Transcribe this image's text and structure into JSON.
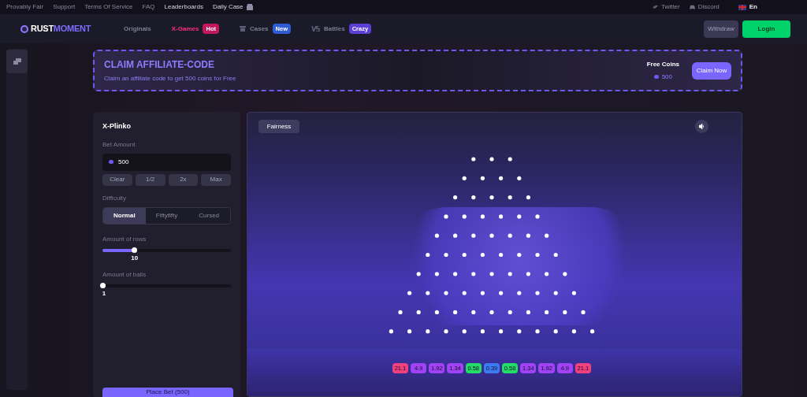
{
  "top_links": [
    {
      "label": "Provably Fair",
      "highlighted": false
    },
    {
      "label": "Support",
      "highlighted": false
    },
    {
      "label": "Terms Of Service",
      "highlighted": false
    },
    {
      "label": "FAQ",
      "highlighted": false
    },
    {
      "label": "Leaderboards",
      "highlighted": true
    },
    {
      "label": "Daily Case",
      "highlighted": true
    }
  ],
  "social": [
    {
      "label": "Twitter",
      "kind": "twitter"
    },
    {
      "label": "Discord",
      "kind": "discord"
    }
  ],
  "language": "En",
  "logo": {
    "first": "RUST",
    "second": "MOMENT"
  },
  "nav": [
    {
      "label": "Originals",
      "selected": false,
      "kind": "plain"
    },
    {
      "label": "X-Games",
      "selected": true,
      "badge": {
        "text": "Hot",
        "color": "#c2185b"
      },
      "kind": "plain"
    },
    {
      "label": "Cases",
      "selected": false,
      "badge": {
        "text": "New",
        "color": "#2f5bd3"
      },
      "kind": "box"
    },
    {
      "label": "Battles",
      "selected": false,
      "badge": {
        "text": "Crazy",
        "color": "#5b3fd6"
      },
      "kind": "vs"
    }
  ],
  "header_buttons": {
    "withdraw": "Withdraw",
    "login": "Login"
  },
  "banner": {
    "title": "CLAIM AFFILIATE-CODE",
    "subtitle": "Claim an affiliate code to get 500 coins for Free",
    "coins_label": "Free Coins",
    "coins": "500",
    "button": "Claim Now"
  },
  "panel": {
    "title": "X-Plinko",
    "bet_label": "Bet Amount",
    "bet_value": "500",
    "bet_buttons": [
      "Clear",
      "1/2",
      "2x",
      "Max"
    ],
    "difficulty_label": "Difficulty",
    "difficulties": [
      {
        "label": "Normal",
        "selected": true
      },
      {
        "label": "Fiftyfifty",
        "selected": false
      },
      {
        "label": "Cursed",
        "selected": false
      }
    ],
    "sliders": [
      {
        "label": "Amount of rows",
        "level": 0.25,
        "reading": "10"
      },
      {
        "label": "Amount of balls",
        "level": 0,
        "reading": "1"
      }
    ],
    "place_bet": "Place Bet (500)"
  },
  "game": {
    "fairness": "Fairness",
    "slots": [
      {
        "text": "21.1",
        "color": "#f0407e"
      },
      {
        "text": "4.9",
        "color": "#a142f4"
      },
      {
        "text": "1.92",
        "color": "#a142f4"
      },
      {
        "text": "1.34",
        "color": "#a142f4"
      },
      {
        "text": "0.58",
        "color": "#22dd66"
      },
      {
        "text": "0.39",
        "color": "#3d7bf2"
      },
      {
        "text": "0.58",
        "color": "#22dd66"
      },
      {
        "text": "1.34",
        "color": "#a142f4"
      },
      {
        "text": "1.92",
        "color": "#a142f4"
      },
      {
        "text": "4.9",
        "color": "#a142f4"
      },
      {
        "text": "21.1",
        "color": "#f0407e"
      }
    ]
  }
}
